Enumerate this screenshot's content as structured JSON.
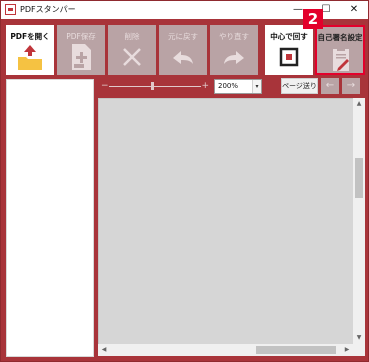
{
  "window": {
    "title": "PDFスタンパー",
    "minimize": "—",
    "maximize": "☐",
    "close": "✕"
  },
  "toolbar": {
    "open_label": "PDFを開く",
    "save_label": "PDF保存",
    "delete_label": "削除",
    "undo_label": "元に戻す",
    "redo_label": "やり直す",
    "center_label": "中心で回す",
    "seal_label": "自己署名設定"
  },
  "annotation": {
    "step_number": "2"
  },
  "zoom": {
    "minus": "−",
    "plus": "+",
    "value": "200%",
    "dropdown_arrow": "▾"
  },
  "page_nav": {
    "label": "ページ送り",
    "prev": "←",
    "next": "→"
  },
  "scrollbars": {
    "up": "▲",
    "down": "▼",
    "left": "◀",
    "right": "▶"
  },
  "colors": {
    "window_frame": "#a8343a",
    "accent_red": "#e3002b",
    "disabled_button": "#b9a3a5",
    "folder_yellow": "#f5c242",
    "canvas": "#d6d6d6"
  },
  "icons": {
    "open": "folder-upload-icon",
    "save": "document-add-icon",
    "delete": "x-icon",
    "undo": "arrow-left-icon",
    "redo": "arrow-right-icon",
    "center": "center-square-icon",
    "seal": "clipboard-pen-icon"
  }
}
